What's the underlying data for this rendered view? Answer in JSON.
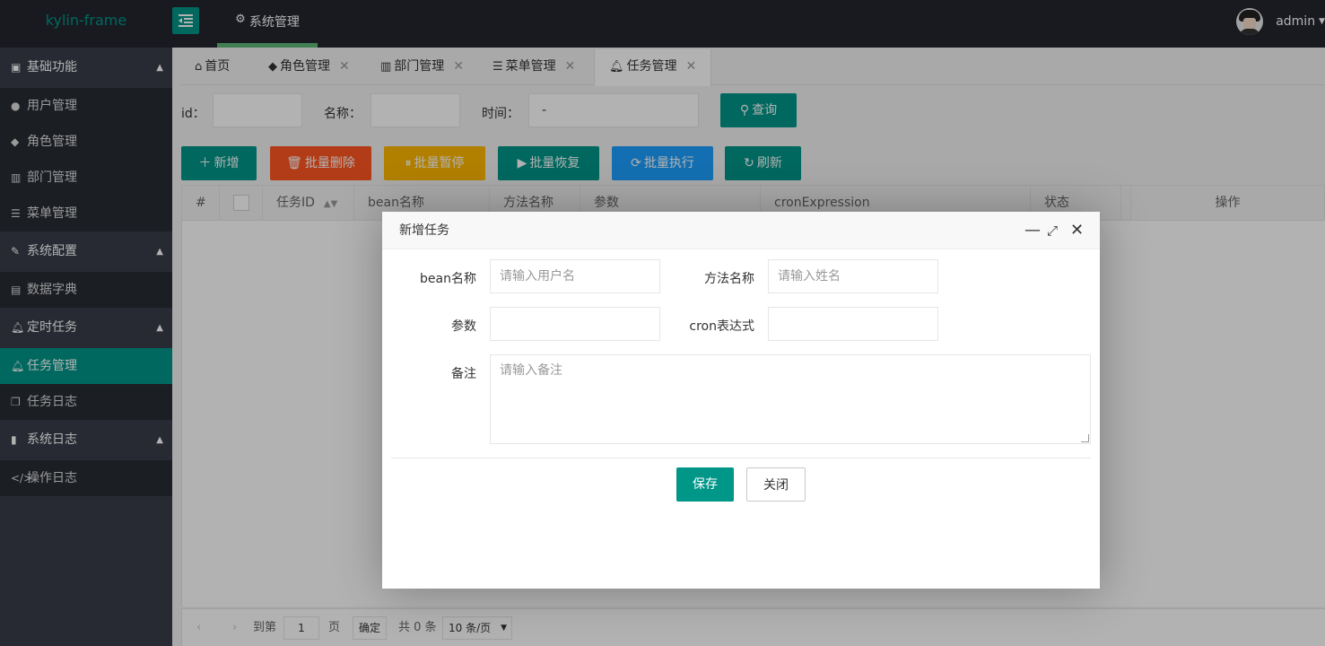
{
  "header": {
    "logo": "kylin-frame",
    "top_nav_label": "系统管理",
    "username": "admin"
  },
  "sidebar": {
    "groups": [
      {
        "label": "基础功能",
        "items": [
          "用户管理",
          "角色管理",
          "部门管理",
          "菜单管理"
        ]
      },
      {
        "label": "系统配置",
        "items": [
          "数据字典"
        ]
      },
      {
        "label": "定时任务",
        "items": [
          "任务管理",
          "任务日志"
        ]
      },
      {
        "label": "系统日志",
        "items": [
          "操作日志"
        ]
      }
    ],
    "active_item": "任务管理"
  },
  "tabs": [
    {
      "label": "首页"
    },
    {
      "label": "角色管理"
    },
    {
      "label": "部门管理"
    },
    {
      "label": "菜单管理"
    },
    {
      "label": "任务管理"
    }
  ],
  "search": {
    "id_label": "id：",
    "name_label": "名称：",
    "time_label": "时间：",
    "time_value": "-",
    "query_button": "查询"
  },
  "toolbar": {
    "add": "新增",
    "batch_delete": "批量删除",
    "batch_pause": "批量暂停",
    "batch_resume": "批量恢复",
    "batch_run": "批量执行",
    "refresh": "刷新"
  },
  "table": {
    "columns": [
      "#",
      "任务ID",
      "bean名称",
      "方法名称",
      "参数",
      "cronExpression",
      "状态",
      "操作"
    ]
  },
  "pager": {
    "goto_label": "到第",
    "page_value": "1",
    "page_suffix": "页",
    "confirm": "确定",
    "total": "共 0 条",
    "page_size": "10 条/页"
  },
  "modal": {
    "title": "新增任务",
    "bean_label": "bean名称",
    "bean_placeholder": "请输入用户名",
    "method_label": "方法名称",
    "method_placeholder": "请输入姓名",
    "params_label": "参数",
    "cron_label": "cron表达式",
    "remark_label": "备注",
    "remark_placeholder": "请输入备注",
    "save": "保存",
    "close": "关闭"
  },
  "colors": {
    "primary": "#009688",
    "danger": "#ff5722",
    "warm": "#ffb800",
    "normal": "#1e9fff",
    "sidebar": "#393d49",
    "header": "#23262e"
  }
}
